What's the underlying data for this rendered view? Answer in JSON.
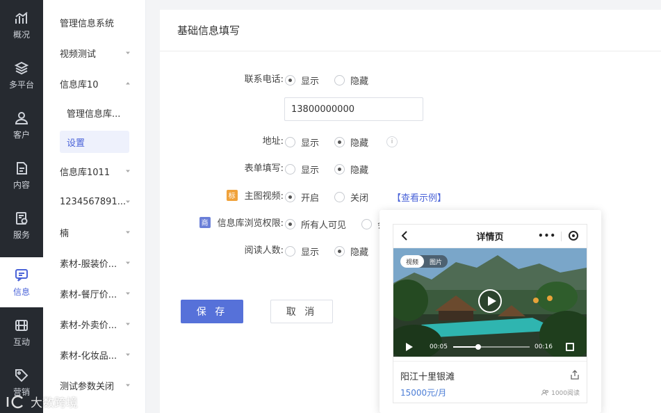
{
  "rail": {
    "items": [
      {
        "label": "概况",
        "icon": "chart-icon"
      },
      {
        "label": "多平台",
        "icon": "layers-icon"
      },
      {
        "label": "客户",
        "icon": "user-icon"
      },
      {
        "label": "内容",
        "icon": "document-icon"
      },
      {
        "label": "服务",
        "icon": "service-icon"
      },
      {
        "label": "信息",
        "icon": "message-icon",
        "active": true
      },
      {
        "label": "互动",
        "icon": "interact-icon"
      },
      {
        "label": "营销",
        "icon": "tag-icon"
      }
    ]
  },
  "subnav": {
    "items": [
      {
        "label": "管理信息系统"
      },
      {
        "label": "视频测试"
      },
      {
        "label": "信息库10"
      },
      {
        "label": "信息库1011"
      },
      {
        "label": "1234567891..."
      },
      {
        "label": "楠"
      },
      {
        "label": "素材-服装价..."
      },
      {
        "label": "素材-餐厅价..."
      },
      {
        "label": "素材-外卖价..."
      },
      {
        "label": "素材-化妆品..."
      },
      {
        "label": "测试参数关闭"
      }
    ],
    "children": [
      {
        "label": "管理信息库..."
      },
      {
        "label": "设置"
      }
    ]
  },
  "panel": {
    "title": "基础信息填写",
    "phone": {
      "label": "联系电话:",
      "show": "显示",
      "hide": "隐藏",
      "value": "13800000000"
    },
    "address": {
      "label": "地址:",
      "show": "显示",
      "hide": "隐藏",
      "info": "i"
    },
    "form": {
      "label": "表单填写:",
      "show": "显示",
      "hide": "隐藏"
    },
    "video": {
      "tag": "标",
      "label": "主图视频:",
      "on": "开启",
      "off": "关闭",
      "example_link": "【查看示例】"
    },
    "permission": {
      "tag": "商",
      "label": "信息库浏览权限:",
      "all": "所有人可见",
      "other": "会"
    },
    "readers": {
      "label": "阅读人数:",
      "show": "显示",
      "hide": "隐藏"
    },
    "save": "保 存",
    "cancel": "取 消"
  },
  "preview": {
    "page_title": "详情页",
    "more": "•••",
    "tabs": [
      "视频",
      "图片"
    ],
    "time_current": "00:05",
    "time_total": "00:16",
    "progress": 0.33,
    "title": "阳江十里银滩",
    "price": "15000元/月",
    "reads": "1000阅读"
  },
  "watermark": "大数跨境",
  "colors": {
    "accent": "#4a63d8",
    "primary_button": "#5671d9",
    "rail_bg": "#262a30",
    "tag_orange": "#f0a23b",
    "tag_blue": "#6a7fd8"
  }
}
